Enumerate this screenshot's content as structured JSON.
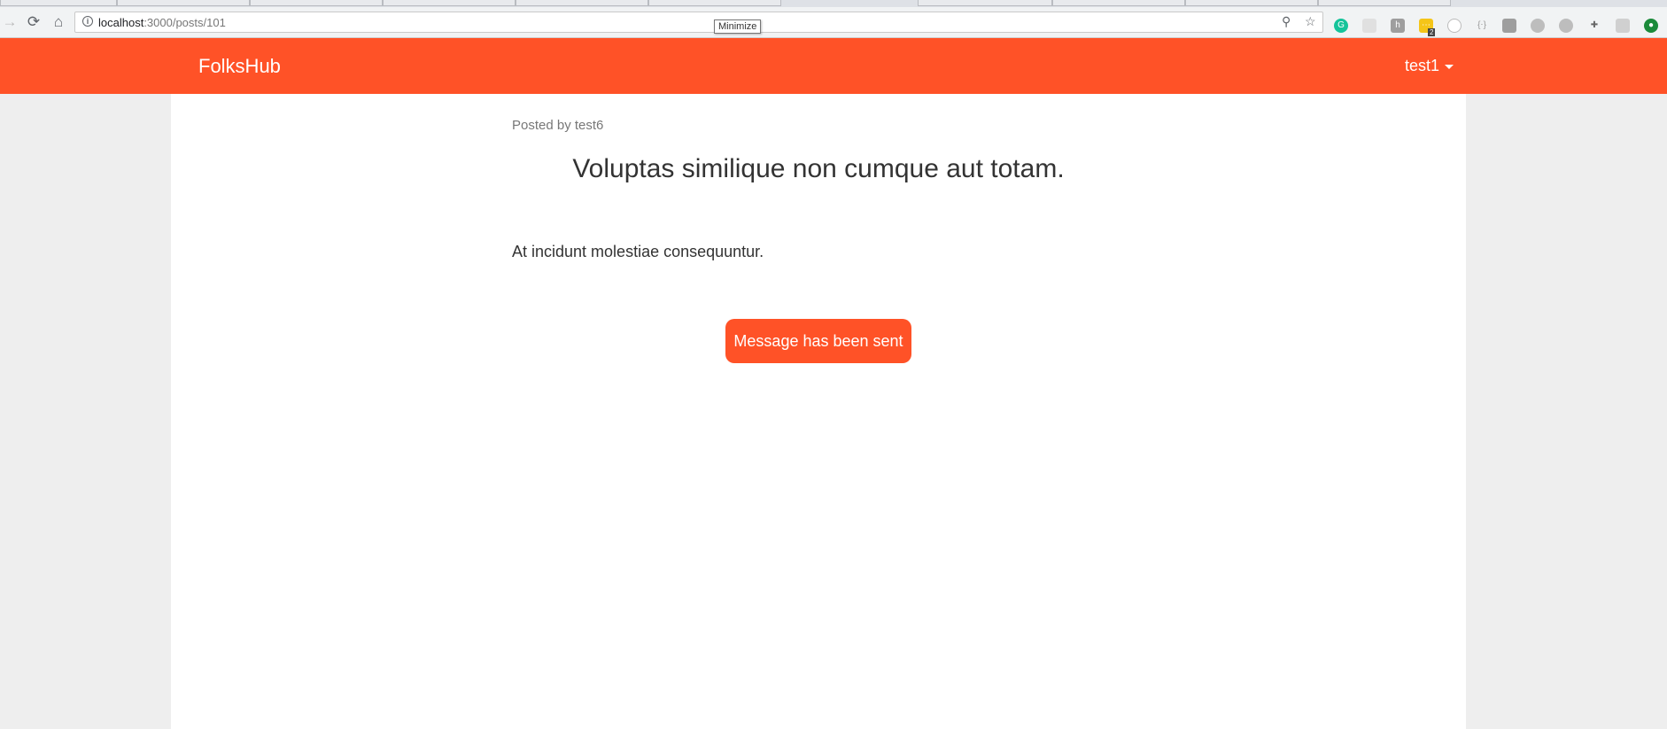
{
  "browser": {
    "url_host": "localhost",
    "url_path": ":3000/posts/101",
    "tooltip": "Minimize",
    "extension_badge": "2"
  },
  "navbar": {
    "brand": "FolksHub",
    "user": "test1"
  },
  "post": {
    "posted_by": "Posted by test6",
    "title": "Voluptas similique non cumque aut totam.",
    "body": "At incidunt molestiae consequuntur.",
    "status_button": "Message has been sent"
  },
  "colors": {
    "accent": "#ff5227",
    "background": "#eeeeee",
    "panel": "#ffffff"
  }
}
